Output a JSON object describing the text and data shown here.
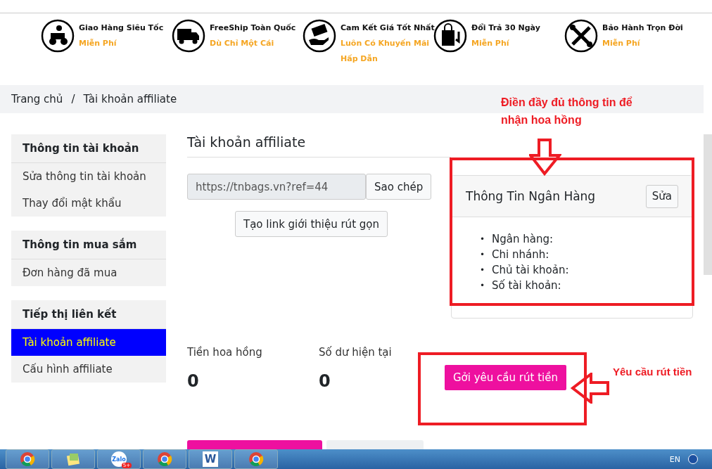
{
  "features": [
    {
      "title": "Giao Hàng Siêu Tốc",
      "subtitle": [
        "Miễn Phí"
      ]
    },
    {
      "title": "FreeShip Toàn Quốc",
      "subtitle": [
        "Dù Chỉ Một Cái"
      ]
    },
    {
      "title": "Cam Kết Giá Tốt Nhất",
      "subtitle": [
        "Luôn Có Khuyến Mãi",
        "Hấp Dẫn"
      ]
    },
    {
      "title": "Đổi Trả 30 Ngày",
      "subtitle": [
        "Miễn Phí"
      ]
    },
    {
      "title": "Bảo Hành Trọn Đời",
      "subtitle": [
        "Miễn Phí"
      ]
    }
  ],
  "breadcrumb": {
    "home": "Trang chủ",
    "separator": "/",
    "current": "Tài khoản affiliate"
  },
  "sidebar": {
    "groups": [
      {
        "title": "Thông tin tài khoản",
        "items": [
          {
            "label": "Sửa thông tin tài khoản",
            "selected": false
          },
          {
            "label": "Thay đổi mật khẩu",
            "selected": false
          }
        ]
      },
      {
        "title": "Thông tin mua sắm",
        "items": [
          {
            "label": "Đơn hàng đã mua",
            "selected": false
          }
        ]
      },
      {
        "title": "Tiếp thị liên kết",
        "items": [
          {
            "label": "Tài khoản affiliate",
            "selected": true
          },
          {
            "label": "Cấu hình affiliate",
            "selected": false
          }
        ]
      }
    ]
  },
  "main": {
    "title": "Tài khoản affiliate",
    "link_value": "https://tnbags.vn?ref=44",
    "copy_button": "Sao chép",
    "shorten_button": "Tạo link giới thiệu rút gọn",
    "stats": [
      {
        "label": "Tiền hoa hồng",
        "value": "0"
      },
      {
        "label": "Số dư hiện tại",
        "value": "0"
      }
    ],
    "withdraw_button": "Gởi yêu cầu rút tiền"
  },
  "bank_card": {
    "title": "Thông Tin Ngân Hàng",
    "edit_button": "Sửa",
    "bullet": "•",
    "fields": [
      "Ngân hàng:",
      "Chi nhánh:",
      "Chủ tài khoản:",
      "Số tài khoản:"
    ]
  },
  "annotations": [
    {
      "text": "Điền đầy đủ thông tin để nhận hoa hồng"
    },
    {
      "text": "Yêu cầu rút tiền"
    }
  ],
  "taskbar": {
    "apps": [
      {
        "kind": "chrome"
      },
      {
        "kind": "notes"
      },
      {
        "kind": "zalo",
        "label": "Zalo",
        "badge": "5+"
      },
      {
        "kind": "chrome"
      },
      {
        "kind": "word",
        "label": "W"
      },
      {
        "kind": "chrome"
      }
    ],
    "language": "EN"
  }
}
